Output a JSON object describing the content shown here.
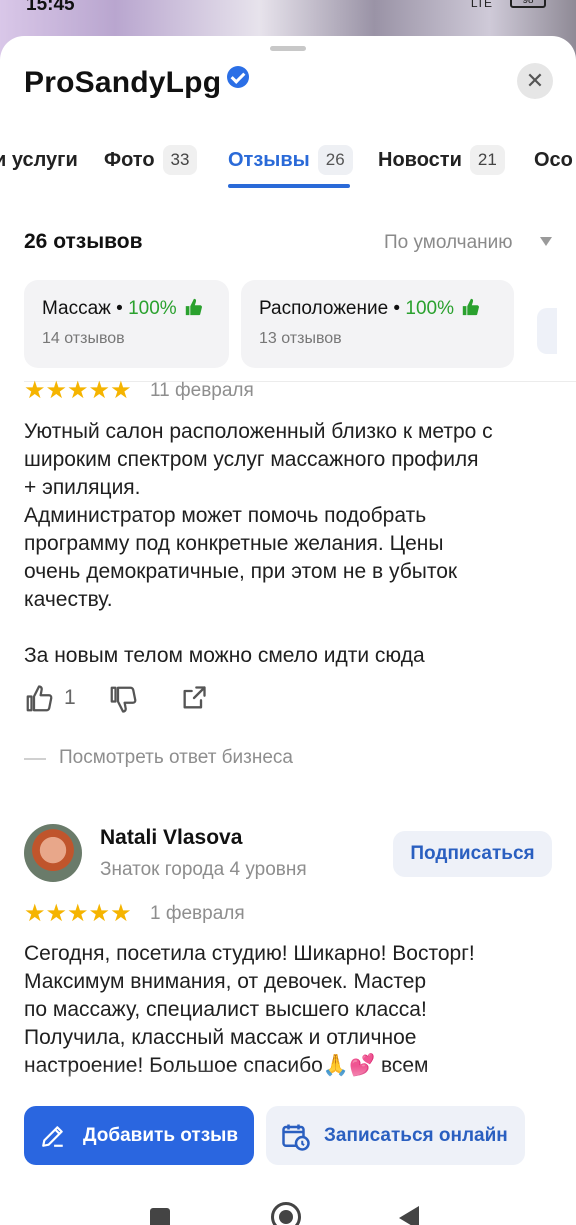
{
  "status_bar": {
    "time": "15:45",
    "network": "LTE",
    "battery": "98"
  },
  "header": {
    "title": "ProSandyLpg",
    "close_icon": "close-icon"
  },
  "tabs": [
    {
      "label": "и услуги",
      "count": ""
    },
    {
      "label": "Фото",
      "count": "33"
    },
    {
      "label": "Отзывы",
      "count": "26",
      "active": true
    },
    {
      "label": "Новости",
      "count": "21"
    },
    {
      "label": "Осо",
      "count": ""
    }
  ],
  "reviews": {
    "total_label": "26 отзывов",
    "sort_label": "По умолчанию",
    "aspects": [
      {
        "name": "Массаж",
        "percent": "100%",
        "sub": "14 отзывов"
      },
      {
        "name": "Расположение",
        "percent": "100%",
        "sub": "13 отзывов"
      }
    ]
  },
  "review1": {
    "stars": "★★★★★",
    "date": "11 февраля",
    "text": "Уютный салон расположенный близко к метро с\nшироким спектром услуг массажного профиля\n+ эпиляция.\nАдминистратор может помочь подобрать\nпрограмму под конкретные желания. Цены\nочень демократичные, при этом не в убыток\nкачеству.\n\nЗа новым телом можно смело идти сюда",
    "likes": "1",
    "business_reply": "Посмотреть ответ бизнеса"
  },
  "review2": {
    "author": "Natali Vlasova",
    "level": "Знаток города 4 уровня",
    "subscribe_label": "Подписаться",
    "stars": "★★★★★",
    "date": "1 февраля",
    "text": "Сегодня, посетила студию! Шикарно! Восторг!\nМаксимум внимания, от девочек. Мастер\nпо массажу, специалист высшего класса!\nПолучила, классный массаж и отличное\nнастроение! Большое спасибо🙏💕 всем\nрекомендую"
  },
  "bottom_actions": {
    "add_review": "Добавить отзыв",
    "book_online": "Записаться онлайн"
  },
  "colors": {
    "accent": "#2a66e0",
    "positive": "#2aa12e",
    "star": "#f5b400"
  }
}
